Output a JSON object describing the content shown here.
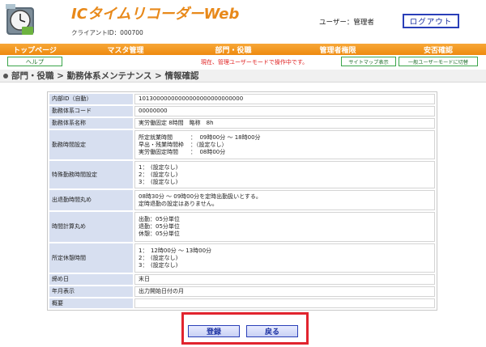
{
  "header": {
    "app_title": "ICタイムリコーダーWeb",
    "client_id": "クライアントID：000700",
    "user_label": "ユーザー：管理者",
    "logout_label": "ログアウト"
  },
  "nav": {
    "items": [
      "トップページ",
      "マスタ管理",
      "部門・役職",
      "管理者権限",
      "安否確認"
    ]
  },
  "subbar": {
    "help_label": "ヘルプ",
    "mode_text": "現在、管理ユーザーモードで操作中です。",
    "sitemap_label": "サイトマップ表示",
    "switch_mode_label": "一般ユーザーモードに切替"
  },
  "breadcrumb": "部門・役職 > 勤務体系メンテナンス > 情報確認",
  "detail": {
    "internal_id": {
      "label": "内部ID（自動）",
      "value": "10130000000000000000000000000"
    },
    "code": {
      "label": "勤務体系コード",
      "value": "00000000"
    },
    "name": {
      "label": "勤務体系名称",
      "value": "実労働固定 8時間　略称　8h"
    },
    "work_time": {
      "label": "勤務時間設定",
      "lines": [
        {
          "k": "所定就業時間",
          "v": "：  09時00分 ～ 18時00分"
        },
        {
          "k": "早出・残業時間枠",
          "v": "：（設定なし）"
        },
        {
          "k": "実労働固定時間",
          "v": "：  08時00分"
        }
      ]
    },
    "special_time": {
      "label": "特殊勤務時間設定",
      "lines": [
        "1：　(設定なし)",
        "2：　(設定なし)",
        "3：　(設定なし)"
      ]
    },
    "rounding_in_out": {
      "label": "出退勤時間丸め",
      "lines": [
        "08時30分 ～ 09時00分を定時出勤扱いとする。",
        "定時退勤の設定はありません。"
      ]
    },
    "calc_rounding": {
      "label": "時間計算丸め",
      "lines": [
        "出勤：05分単位",
        "退勤：05分単位",
        "休憩：05分単位"
      ]
    },
    "break_time": {
      "label": "所定休憩時間",
      "lines": [
        "1：　12時00分 ～ 13時00分",
        "2：　(設定なし)",
        "3：　(設定なし)"
      ]
    },
    "closing_day": {
      "label": "締め日",
      "value": "末日"
    },
    "year_month": {
      "label": "年月表示",
      "value": "出力開始日付の月"
    },
    "summary": {
      "label": "概要",
      "value": ""
    }
  },
  "actions": {
    "register_label": "登録",
    "back_label": "戻る"
  },
  "colors": {
    "accent_orange": "#ee8a0f",
    "highlight_red": "#e1242e",
    "button_blue": "#2a3fb8",
    "label_bg": "#d7dff0"
  },
  "icons": [
    "clock-logo-icon",
    "bullet-icon"
  ]
}
